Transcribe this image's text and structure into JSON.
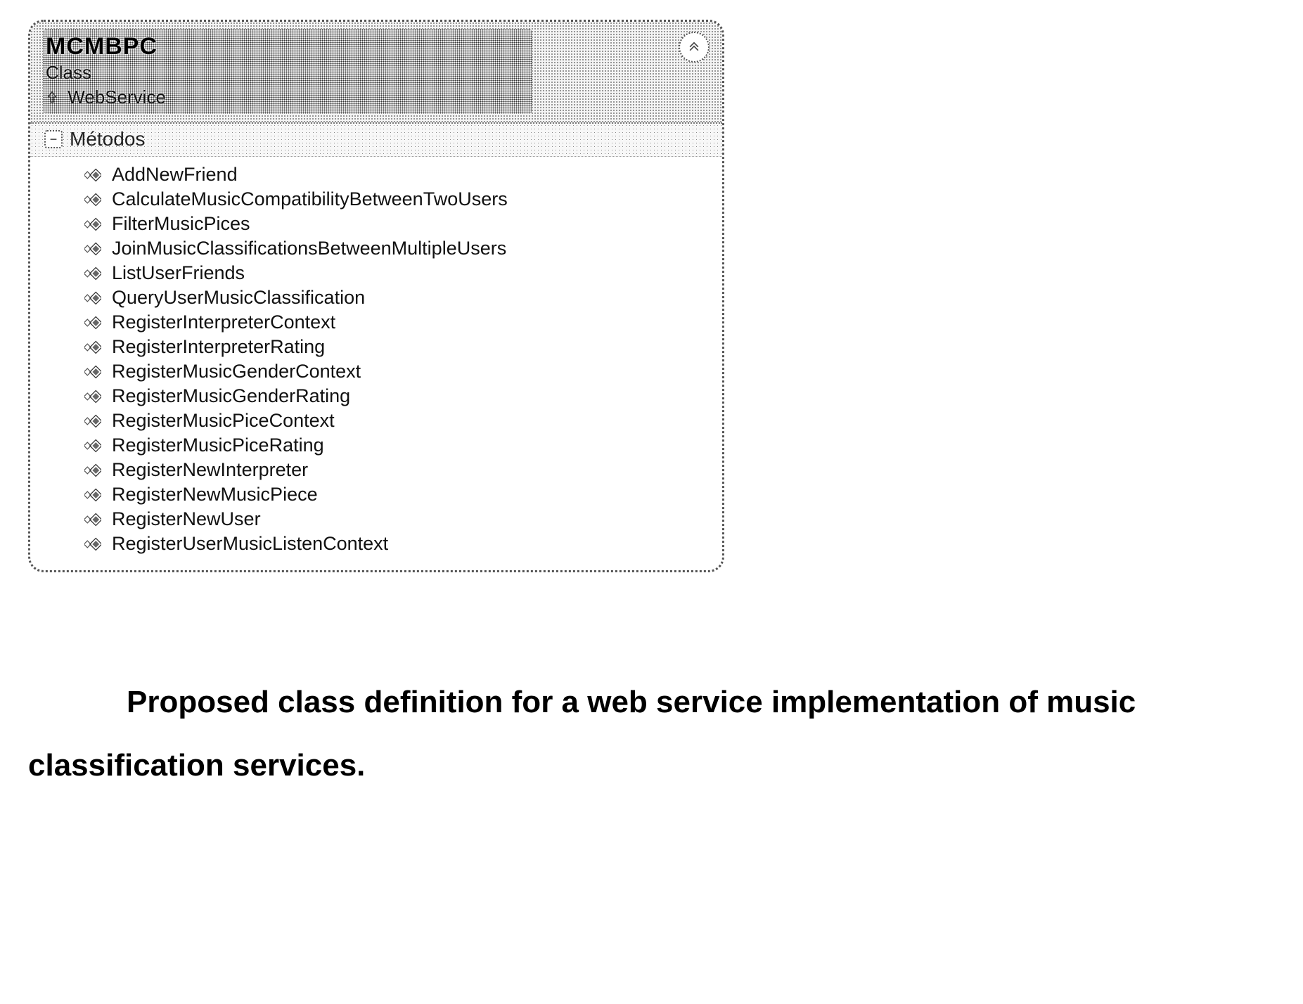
{
  "class": {
    "name": "MCMBPC",
    "type_label": "Class",
    "base_prefix_icon": "inherits-arrow-icon",
    "base_class": "WebService",
    "section_label": "Métodos",
    "methods": [
      "AddNewFriend",
      "CalculateMusicCompatibilityBetweenTwoUsers",
      "FilterMusicPices",
      "JoinMusicClassificationsBetweenMultipleUsers",
      "ListUserFriends",
      "QueryUserMusicClassification",
      "RegisterInterpreterContext",
      "RegisterInterpreterRating",
      "RegisterMusicGenderContext",
      "RegisterMusicGenderRating",
      "RegisterMusicPiceContext",
      "RegisterMusicPiceRating",
      "RegisterNewInterpreter",
      "RegisterNewMusicPiece",
      "RegisterNewUser",
      "RegisterUserMusicListenContext"
    ]
  },
  "caption": {
    "line1": "Proposed class definition for a web service implementation of music",
    "line2": "classification services."
  }
}
